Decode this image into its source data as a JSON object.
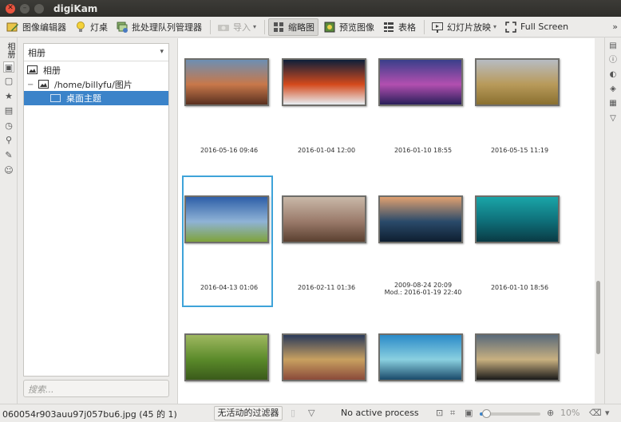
{
  "window": {
    "title": "digiKam"
  },
  "toolbar": {
    "image_editor": "图像编辑器",
    "light_table": "灯桌",
    "batch_queue": "批处理队列管理器",
    "import": "导入",
    "thumbnails": "缩略图",
    "preview": "预览图像",
    "table": "表格",
    "slideshow": "幻灯片放映",
    "fullscreen": "Full Screen",
    "more": "»"
  },
  "left_strip": {
    "vertical_label": "相册"
  },
  "album_panel": {
    "header": "相册",
    "tree": [
      {
        "label": "相册"
      },
      {
        "label": "/home/billyfu/图片",
        "expander": "−"
      },
      {
        "label": "桌面主题"
      }
    ],
    "search_placeholder": "搜索..."
  },
  "thumbnails": [
    {
      "date": "2016-05-16 09:46",
      "colors": [
        "#6d8fb3",
        "#c8784a",
        "#5a3020"
      ]
    },
    {
      "date": "2016-01-04 12:00",
      "colors": [
        "#0d1f3a",
        "#d44a1c",
        "#e8eef2"
      ]
    },
    {
      "date": "2016-01-10 18:55",
      "colors": [
        "#3a3f8a",
        "#b24fb0",
        "#2a1f5a"
      ]
    },
    {
      "date": "2016-05-15 11:19",
      "colors": [
        "#b7bcc2",
        "#b89a5a",
        "#8a7030"
      ]
    },
    {
      "date": "2016-04-13 01:06",
      "colors": [
        "#2e5fa8",
        "#8fb3d6",
        "#7fa33a"
      ]
    },
    {
      "date": "2016-02-11 01:36",
      "colors": [
        "#c9b8a8",
        "#9a7a6a",
        "#5a4030"
      ]
    },
    {
      "date": "2009-08-24 20:09",
      "date2": "Mod.: 2016-01-19 22:40",
      "colors": [
        "#e0a070",
        "#2a4a6a",
        "#0e1e30"
      ]
    },
    {
      "date": "2016-01-10 18:56",
      "colors": [
        "#1aa5a8",
        "#0e6e78",
        "#0a3a44"
      ]
    },
    {
      "date": "",
      "colors": [
        "#9fb860",
        "#5a8a2a",
        "#3a5a1a"
      ]
    },
    {
      "date": "",
      "colors": [
        "#2a3a5a",
        "#c8a060",
        "#8a4a3a"
      ]
    },
    {
      "date": "",
      "colors": [
        "#2a8ac8",
        "#8ad0e0",
        "#1a4a6a"
      ]
    },
    {
      "date": "",
      "colors": [
        "#5a6a7a",
        "#c8b080",
        "#1a1a1a"
      ]
    }
  ],
  "status": {
    "file_info": "060054r903auu97j057bu6.jpg (45 的 1)",
    "filter": "无活动的过滤器",
    "process": "No active process",
    "zoom": "10%",
    "zoom_level": 0.1
  },
  "icons": {
    "close": "close-icon",
    "minimize": "minimize-icon",
    "maximize": "maximize-icon"
  }
}
